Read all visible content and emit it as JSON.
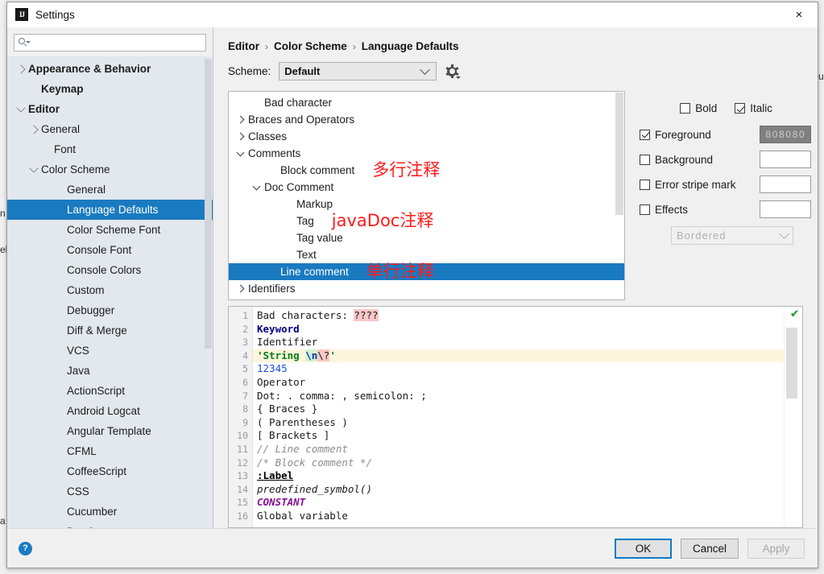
{
  "window": {
    "title": "Settings",
    "logo_text": "IJ",
    "close_icon": "×"
  },
  "search": {
    "placeholder": "",
    "value": ""
  },
  "sidebar": {
    "items": [
      {
        "label": "Appearance & Behavior",
        "indent": 0,
        "arrow": "right",
        "bold": true,
        "selected": false
      },
      {
        "label": "Keymap",
        "indent": 1,
        "arrow": "none",
        "bold": true,
        "selected": false
      },
      {
        "label": "Editor",
        "indent": 0,
        "arrow": "down",
        "bold": true,
        "selected": false
      },
      {
        "label": "General",
        "indent": 1,
        "arrow": "right",
        "bold": false,
        "selected": false
      },
      {
        "label": "Font",
        "indent": 2,
        "arrow": "none",
        "bold": false,
        "selected": false
      },
      {
        "label": "Color Scheme",
        "indent": 1,
        "arrow": "down",
        "bold": false,
        "selected": false
      },
      {
        "label": "General",
        "indent": 3,
        "arrow": "none",
        "bold": false,
        "selected": false
      },
      {
        "label": "Language Defaults",
        "indent": 3,
        "arrow": "none",
        "bold": false,
        "selected": true
      },
      {
        "label": "Color Scheme Font",
        "indent": 3,
        "arrow": "none",
        "bold": false,
        "selected": false
      },
      {
        "label": "Console Font",
        "indent": 3,
        "arrow": "none",
        "bold": false,
        "selected": false
      },
      {
        "label": "Console Colors",
        "indent": 3,
        "arrow": "none",
        "bold": false,
        "selected": false
      },
      {
        "label": "Custom",
        "indent": 3,
        "arrow": "none",
        "bold": false,
        "selected": false
      },
      {
        "label": "Debugger",
        "indent": 3,
        "arrow": "none",
        "bold": false,
        "selected": false
      },
      {
        "label": "Diff & Merge",
        "indent": 3,
        "arrow": "none",
        "bold": false,
        "selected": false
      },
      {
        "label": "VCS",
        "indent": 3,
        "arrow": "none",
        "bold": false,
        "selected": false
      },
      {
        "label": "Java",
        "indent": 3,
        "arrow": "none",
        "bold": false,
        "selected": false
      },
      {
        "label": "ActionScript",
        "indent": 3,
        "arrow": "none",
        "bold": false,
        "selected": false
      },
      {
        "label": "Android Logcat",
        "indent": 3,
        "arrow": "none",
        "bold": false,
        "selected": false
      },
      {
        "label": "Angular Template",
        "indent": 3,
        "arrow": "none",
        "bold": false,
        "selected": false
      },
      {
        "label": "CFML",
        "indent": 3,
        "arrow": "none",
        "bold": false,
        "selected": false
      },
      {
        "label": "CoffeeScript",
        "indent": 3,
        "arrow": "none",
        "bold": false,
        "selected": false
      },
      {
        "label": "CSS",
        "indent": 3,
        "arrow": "none",
        "bold": false,
        "selected": false
      },
      {
        "label": "Cucumber",
        "indent": 3,
        "arrow": "none",
        "bold": false,
        "selected": false
      },
      {
        "label": "Database",
        "indent": 3,
        "arrow": "none",
        "bold": false,
        "selected": false
      }
    ]
  },
  "breadcrumb": {
    "parts": [
      "Editor",
      "Color Scheme",
      "Language Defaults"
    ],
    "separator": "›"
  },
  "scheme": {
    "label": "Scheme:",
    "value": "Default",
    "gear_icon": "gear-icon"
  },
  "scheme_tree": {
    "items": [
      {
        "label": "Bad character",
        "indent": 1,
        "arrow": "none",
        "selected": false,
        "annotation": ""
      },
      {
        "label": "Braces and Operators",
        "indent": 0,
        "arrow": "right",
        "selected": false,
        "annotation": ""
      },
      {
        "label": "Classes",
        "indent": 0,
        "arrow": "right",
        "selected": false,
        "annotation": ""
      },
      {
        "label": "Comments",
        "indent": 0,
        "arrow": "down",
        "selected": false,
        "annotation": ""
      },
      {
        "label": "Block comment",
        "indent": 2,
        "arrow": "none",
        "selected": false,
        "annotation": "多行注释",
        "ann_size": "big"
      },
      {
        "label": "Doc Comment",
        "indent": 1,
        "arrow": "down",
        "selected": false,
        "annotation": ""
      },
      {
        "label": "Markup",
        "indent": 3,
        "arrow": "none",
        "selected": false,
        "annotation": ""
      },
      {
        "label": "Tag",
        "indent": 3,
        "arrow": "none",
        "selected": false,
        "annotation": "javaDoc注释",
        "ann_size": "big"
      },
      {
        "label": "Tag value",
        "indent": 3,
        "arrow": "none",
        "selected": false,
        "annotation": ""
      },
      {
        "label": "Text",
        "indent": 3,
        "arrow": "none",
        "selected": false,
        "annotation": ""
      },
      {
        "label": "Line comment",
        "indent": 2,
        "arrow": "none",
        "selected": true,
        "annotation": "单行注释",
        "ann_size": "big"
      },
      {
        "label": "Identifiers",
        "indent": 0,
        "arrow": "right",
        "selected": false,
        "annotation": ""
      }
    ]
  },
  "attributes": {
    "font_style": [
      {
        "label": "Bold",
        "checked": false
      },
      {
        "label": "Italic",
        "checked": true
      }
    ],
    "rows": [
      {
        "label": "Foreground",
        "checked": true,
        "swatch_value": "808080",
        "swatch_filled": true
      },
      {
        "label": "Background",
        "checked": false,
        "swatch_value": "",
        "swatch_filled": false
      },
      {
        "label": "Error stripe mark",
        "checked": false,
        "swatch_value": "",
        "swatch_filled": false
      },
      {
        "label": "Effects",
        "checked": false,
        "swatch_value": "",
        "swatch_filled": false
      }
    ],
    "effects_value": "Bordered"
  },
  "preview": {
    "inspection_icon": "checkmark-ok-icon",
    "lines": [
      {
        "n": "1",
        "highlight": false,
        "tokens": [
          {
            "t": "Bad characters: ",
            "c": "plain"
          },
          {
            "t": "????",
            "c": "tk-bad"
          }
        ]
      },
      {
        "n": "2",
        "highlight": false,
        "tokens": [
          {
            "t": "Keyword",
            "c": "tk-kw"
          }
        ]
      },
      {
        "n": "3",
        "highlight": false,
        "tokens": [
          {
            "t": "Identifier",
            "c": "plain"
          }
        ]
      },
      {
        "n": "4",
        "highlight": true,
        "tokens": [
          {
            "t": "'String ",
            "c": "tk-str"
          },
          {
            "t": "\\n",
            "c": "tk-esc"
          },
          {
            "t": "\\?",
            "c": "tk-bad"
          },
          {
            "t": "'",
            "c": "tk-str"
          }
        ]
      },
      {
        "n": "5",
        "highlight": false,
        "tokens": [
          {
            "t": "12345",
            "c": "tk-num"
          }
        ]
      },
      {
        "n": "6",
        "highlight": false,
        "tokens": [
          {
            "t": "Operator",
            "c": "plain"
          }
        ]
      },
      {
        "n": "7",
        "highlight": false,
        "tokens": [
          {
            "t": "Dot: . comma: , semicolon: ;",
            "c": "plain"
          }
        ]
      },
      {
        "n": "8",
        "highlight": false,
        "tokens": [
          {
            "t": "{ Braces }",
            "c": "plain"
          }
        ]
      },
      {
        "n": "9",
        "highlight": false,
        "tokens": [
          {
            "t": "( Parentheses )",
            "c": "plain"
          }
        ]
      },
      {
        "n": "10",
        "highlight": false,
        "tokens": [
          {
            "t": "[ Brackets ]",
            "c": "plain"
          }
        ]
      },
      {
        "n": "11",
        "highlight": false,
        "tokens": [
          {
            "t": "// Line comment",
            "c": "tk-cmt"
          }
        ]
      },
      {
        "n": "12",
        "highlight": false,
        "tokens": [
          {
            "t": "/* Block comment */",
            "c": "tk-cmt"
          }
        ]
      },
      {
        "n": "13",
        "highlight": false,
        "tokens": [
          {
            "t": ":Label",
            "c": "tk-lbl"
          }
        ]
      },
      {
        "n": "14",
        "highlight": false,
        "tokens": [
          {
            "t": "predefined_symbol()",
            "c": "tk-pre"
          }
        ]
      },
      {
        "n": "15",
        "highlight": false,
        "tokens": [
          {
            "t": "CONSTANT",
            "c": "tk-const"
          }
        ]
      },
      {
        "n": "16",
        "highlight": false,
        "tokens": [
          {
            "t": "Global variable",
            "c": "plain"
          }
        ]
      }
    ]
  },
  "footer": {
    "help_label": "?",
    "ok_label": "OK",
    "cancel_label": "Cancel",
    "apply_label": "Apply"
  },
  "colors": {
    "selection_blue": "#1a7ac0",
    "annotation_red": "#ff1a1a",
    "sidebar_bg": "#e2e8ee",
    "dialog_bg": "#f0f0f0",
    "foreground_swatch": "#808080"
  }
}
